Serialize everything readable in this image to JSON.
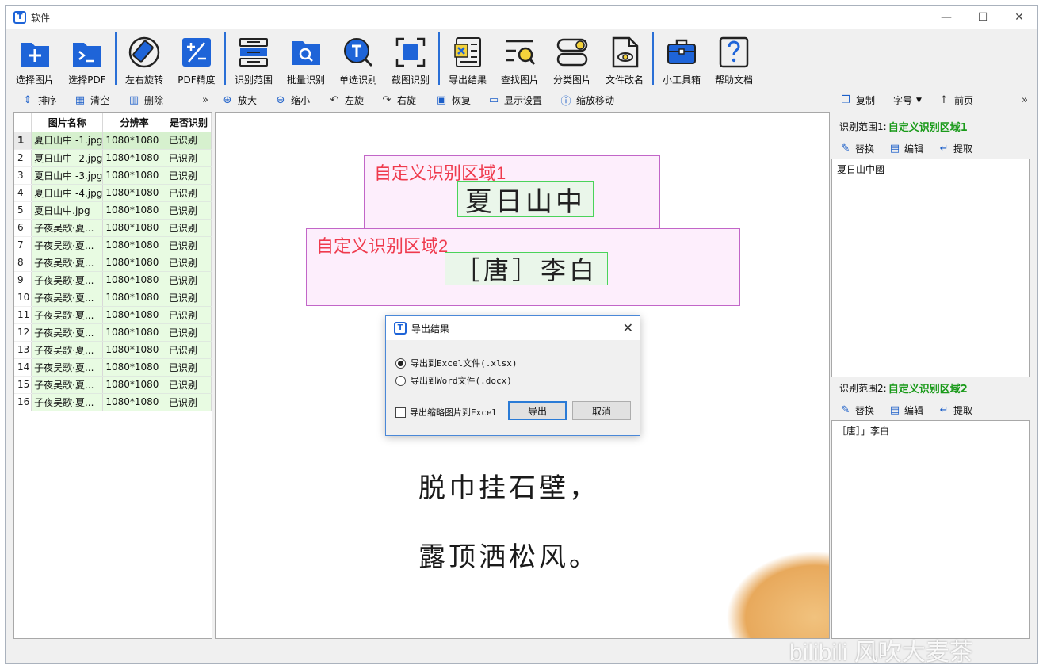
{
  "window": {
    "title": "软件",
    "controls": [
      "—",
      "☐",
      "✕"
    ]
  },
  "toolbar": [
    {
      "label": "选择图片",
      "icon": "add-image-icon"
    },
    {
      "label": "选择PDF",
      "icon": "pdf-folder-icon"
    },
    {
      "label": "左右旋转",
      "icon": "rotate-icon"
    },
    {
      "label": "PDF精度",
      "icon": "pdf-precision-icon"
    },
    {
      "label": "识别范围",
      "icon": "recognition-range-icon"
    },
    {
      "label": "批量识别",
      "icon": "batch-recognize-icon"
    },
    {
      "label": "单选识别",
      "icon": "single-recognize-icon"
    },
    {
      "label": "截图识别",
      "icon": "screenshot-recognize-icon"
    },
    {
      "label": "导出结果",
      "icon": "export-result-icon"
    },
    {
      "label": "查找图片",
      "icon": "find-image-icon"
    },
    {
      "label": "分类图片",
      "icon": "classify-image-icon"
    },
    {
      "label": "文件改名",
      "icon": "rename-file-icon"
    },
    {
      "label": "小工具箱",
      "icon": "toolbox-icon"
    },
    {
      "label": "帮助文档",
      "icon": "help-icon"
    }
  ],
  "options": {
    "sort": "排序",
    "clear": "清空",
    "delete": "删除",
    "zoom_in": "放大",
    "zoom_out": "缩小",
    "rotate_left": "左旋",
    "rotate_right": "右旋",
    "restore": "恢复",
    "display_settings": "显示设置",
    "zoom_move": "缩放移动",
    "copy": "复制",
    "font_size": "字号",
    "prev_page": "前页",
    "more": "»"
  },
  "table": {
    "headers": [
      "图片名称",
      "分辨率",
      "是否识别"
    ],
    "rows": [
      [
        "1",
        "夏日山中 -1.jpg",
        "1080*1080",
        "已识别"
      ],
      [
        "2",
        "夏日山中 -2.jpg",
        "1080*1080",
        "已识别"
      ],
      [
        "3",
        "夏日山中 -3.jpg",
        "1080*1080",
        "已识别"
      ],
      [
        "4",
        "夏日山中 -4.jpg",
        "1080*1080",
        "已识别"
      ],
      [
        "5",
        "夏日山中.jpg",
        "1080*1080",
        "已识别"
      ],
      [
        "6",
        "子夜吴歌·夏...",
        "1080*1080",
        "已识别"
      ],
      [
        "7",
        "子夜吴歌·夏...",
        "1080*1080",
        "已识别"
      ],
      [
        "8",
        "子夜吴歌·夏...",
        "1080*1080",
        "已识别"
      ],
      [
        "9",
        "子夜吴歌·夏...",
        "1080*1080",
        "已识别"
      ],
      [
        "10",
        "子夜吴歌·夏...",
        "1080*1080",
        "已识别"
      ],
      [
        "11",
        "子夜吴歌·夏...",
        "1080*1080",
        "已识别"
      ],
      [
        "12",
        "子夜吴歌·夏...",
        "1080*1080",
        "已识别"
      ],
      [
        "13",
        "子夜吴歌·夏...",
        "1080*1080",
        "已识别"
      ],
      [
        "14",
        "子夜吴歌·夏...",
        "1080*1080",
        "已识别"
      ],
      [
        "15",
        "子夜吴歌·夏...",
        "1080*1080",
        "已识别"
      ],
      [
        "16",
        "子夜吴歌·夏...",
        "1080*1080",
        "已识别"
      ]
    ]
  },
  "canvas": {
    "region1_label": "自定义识别区域1",
    "region1_text": "夏日山中",
    "region2_label": "自定义识别区域2",
    "region2_text": "［唐］李白",
    "poem_line1": "脱巾挂石壁，",
    "poem_line2": "露顶洒松风。"
  },
  "dialog": {
    "title": "导出结果",
    "option_excel": "导出到Excel文件(.xlsx)",
    "option_word": "导出到Word文件(.docx)",
    "thumbnail_checkbox": "导出缩略图片到Excel",
    "export_button": "导出",
    "cancel_button": "取消",
    "selected": "excel",
    "close": "✕"
  },
  "right": {
    "range1_prefix": "识别范围1:",
    "range1_name": "自定义识别区域1",
    "range1_text": "夏日山中國",
    "range2_prefix": "识别范围2:",
    "range2_name": "自定义识别区域2",
    "range2_text": "［唐］」李白",
    "replace": "替换",
    "edit": "编辑",
    "extract": "提取"
  },
  "watermark": "bilibili 风吹大麦茶",
  "colors": {
    "accent": "#1e64d8",
    "region_border": "#c266c8",
    "region_label": "#ef3a4d",
    "ocr_box": "#4ad35a",
    "recognized_row": "#e8fbe2",
    "range_name": "#1a9a1a"
  }
}
